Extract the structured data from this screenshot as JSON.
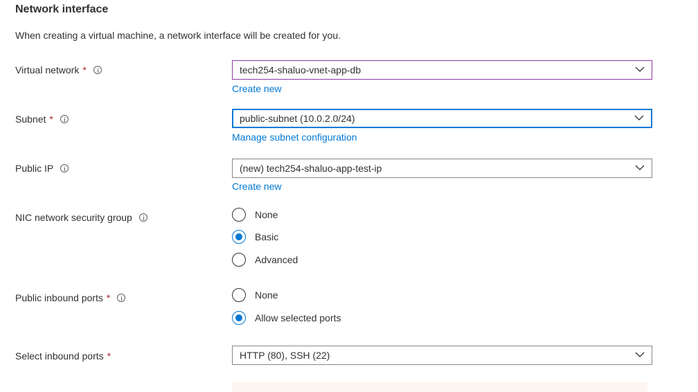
{
  "section": {
    "title": "Network interface",
    "description": "When creating a virtual machine, a network interface will be created for you."
  },
  "virtual_network": {
    "label": "Virtual network",
    "required": "*",
    "value": "tech254-shaluo-vnet-app-db",
    "link": "Create new"
  },
  "subnet": {
    "label": "Subnet",
    "required": "*",
    "value": "public-subnet (10.0.2.0/24)",
    "link": "Manage subnet configuration"
  },
  "public_ip": {
    "label": "Public IP",
    "value": "(new) tech254-shaluo-app-test-ip",
    "link": "Create new"
  },
  "nic_nsg": {
    "label": "NIC network security group",
    "options": [
      "None",
      "Basic",
      "Advanced"
    ],
    "selected": "Basic"
  },
  "public_inbound_ports": {
    "label": "Public inbound ports",
    "required": "*",
    "options": [
      "None",
      "Allow selected ports"
    ],
    "selected": "Allow selected ports"
  },
  "select_inbound_ports": {
    "label": "Select inbound ports",
    "required": "*",
    "value": "HTTP (80), SSH (22)"
  },
  "colors": {
    "accent": "#0078d4",
    "required": "#a4262c",
    "text": "#323130"
  }
}
